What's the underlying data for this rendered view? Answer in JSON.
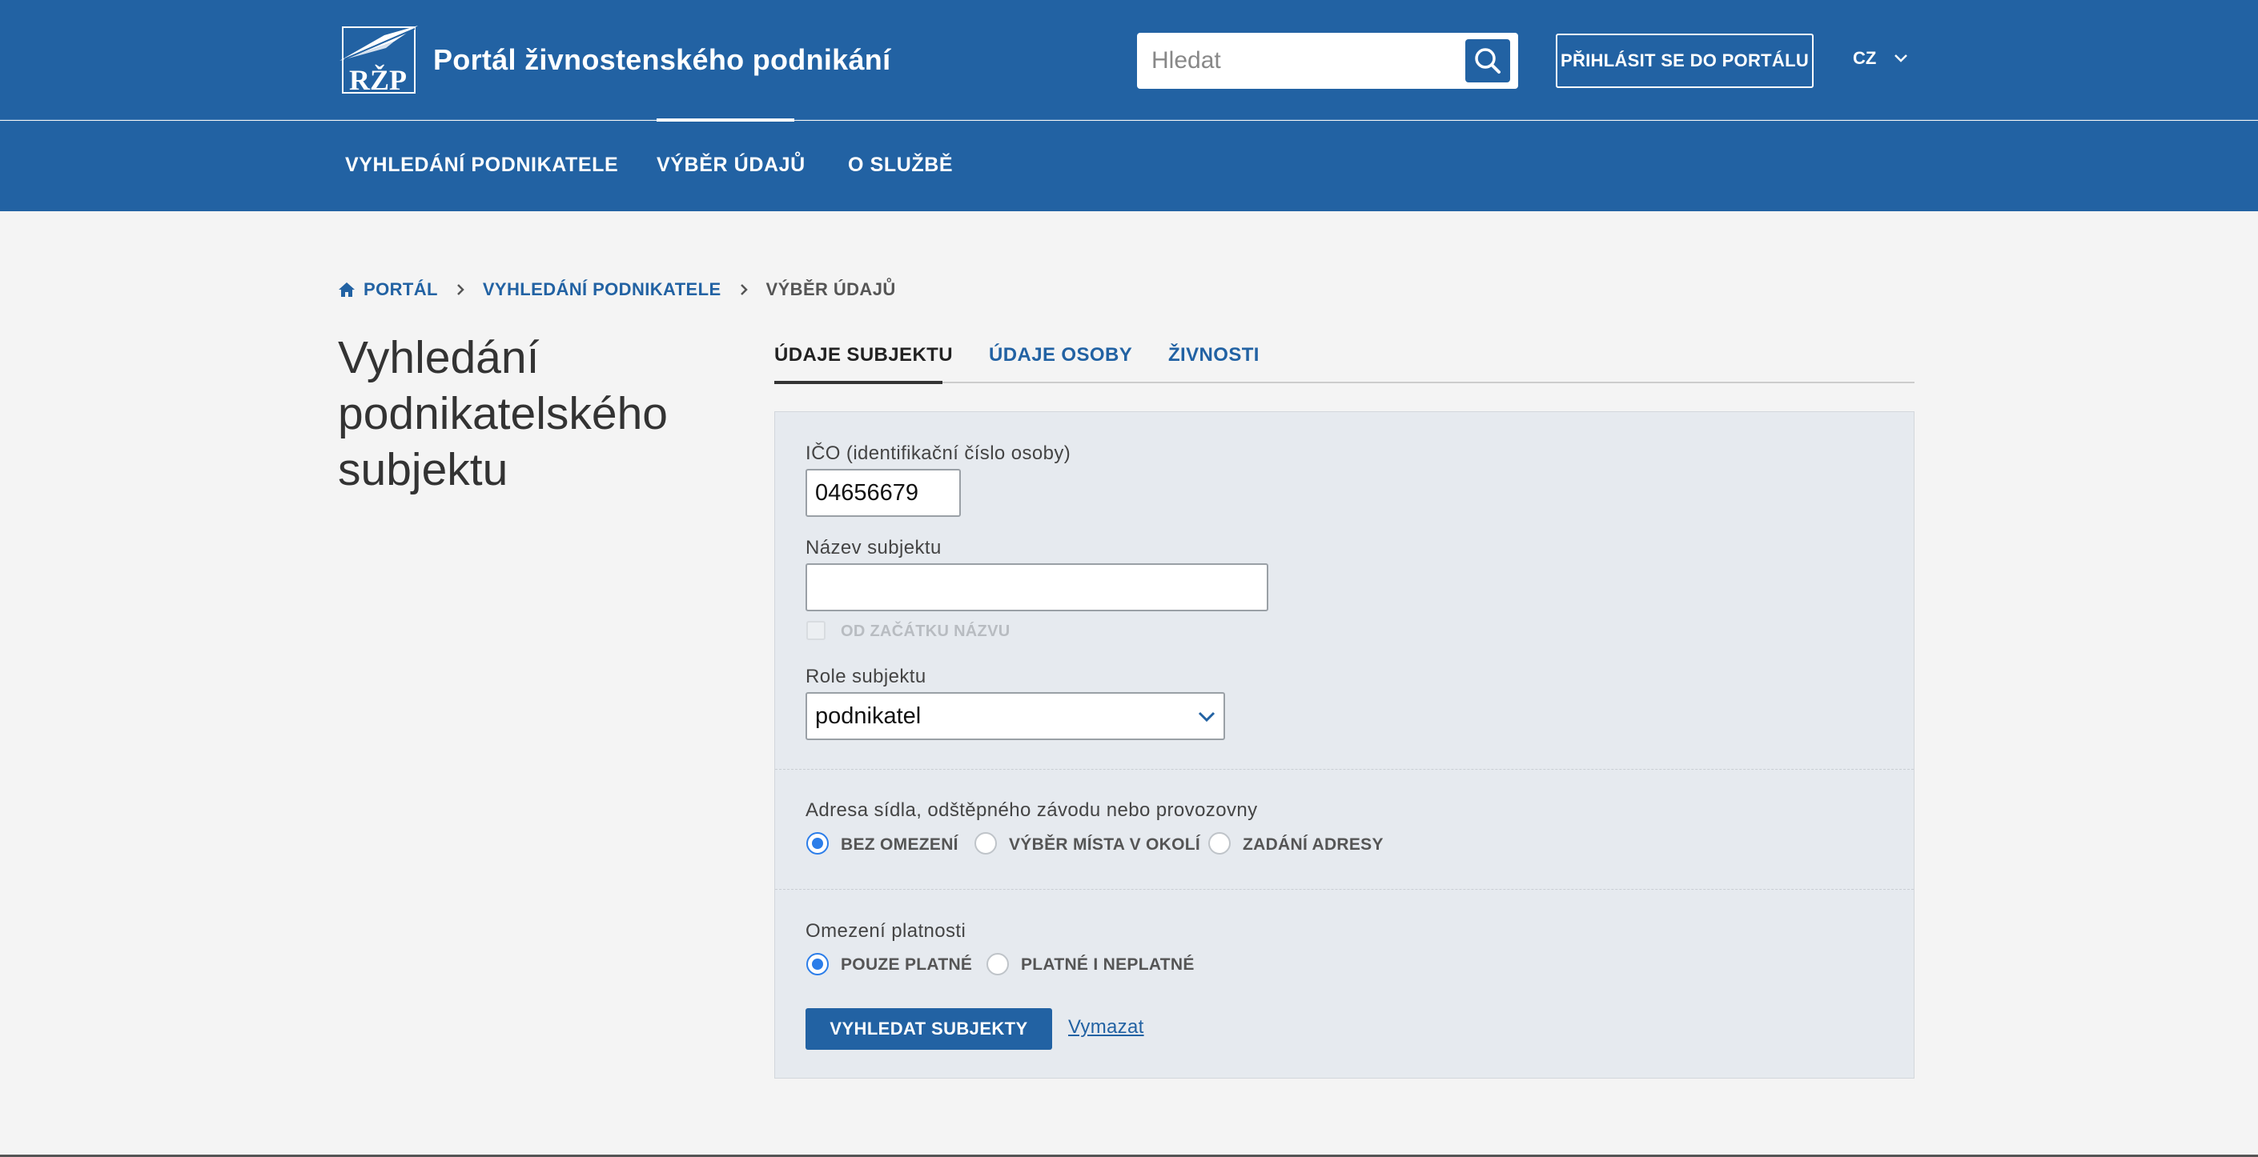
{
  "header": {
    "logo_text": "RŽP",
    "title": "Portál živnostenského podnikání",
    "search_placeholder": "Hledat",
    "login_label": "PŘIHLÁSIT SE DO PORTÁLU",
    "language": "CZ"
  },
  "nav": {
    "items": [
      {
        "label": "VYHLEDÁNÍ PODNIKATELE"
      },
      {
        "label": "VÝBĚR ÚDAJŮ",
        "active": true
      },
      {
        "label": "O SLUŽBĚ"
      }
    ]
  },
  "breadcrumb": {
    "home": "PORTÁL",
    "level1": "VYHLEDÁNÍ PODNIKATELE",
    "current": "VÝBĚR ÚDAJŮ"
  },
  "page": {
    "title_line1": "Vyhledání",
    "title_line2": "podnikatelského",
    "title_line3": "subjektu"
  },
  "tabs": [
    {
      "label": "ÚDAJE SUBJEKTU",
      "active": true
    },
    {
      "label": "ÚDAJE OSOBY"
    },
    {
      "label": "ŽIVNOSTI"
    }
  ],
  "form": {
    "ico_label": "IČO (identifikační číslo osoby)",
    "ico_value": "04656679",
    "name_label": "Název subjektu",
    "name_value": "",
    "from_start_label": "OD ZAČÁTKU NÁZVU",
    "role_label": "Role subjektu",
    "role_value": "podnikatel",
    "address_label": "Adresa sídla, odštěpného závodu nebo provozovny",
    "address_options": [
      {
        "label": "BEZ OMEZENÍ",
        "checked": true
      },
      {
        "label": "VÝBĚR MÍSTA V OKOLÍ",
        "checked": false
      },
      {
        "label": "ZADÁNÍ ADRESY",
        "checked": false
      }
    ],
    "validity_label": "Omezení platnosti",
    "validity_options": [
      {
        "label": "POUZE PLATNÉ",
        "checked": true
      },
      {
        "label": "PLATNÉ I NEPLATNÉ",
        "checked": false
      }
    ],
    "submit_label": "VYHLEDAT SUBJEKTY",
    "clear_label": "Vymazat"
  },
  "colors": {
    "brand": "#2262a3",
    "radio_accent": "#2b7de9",
    "background": "#f4f4f4",
    "panel": "#e6eaef"
  }
}
